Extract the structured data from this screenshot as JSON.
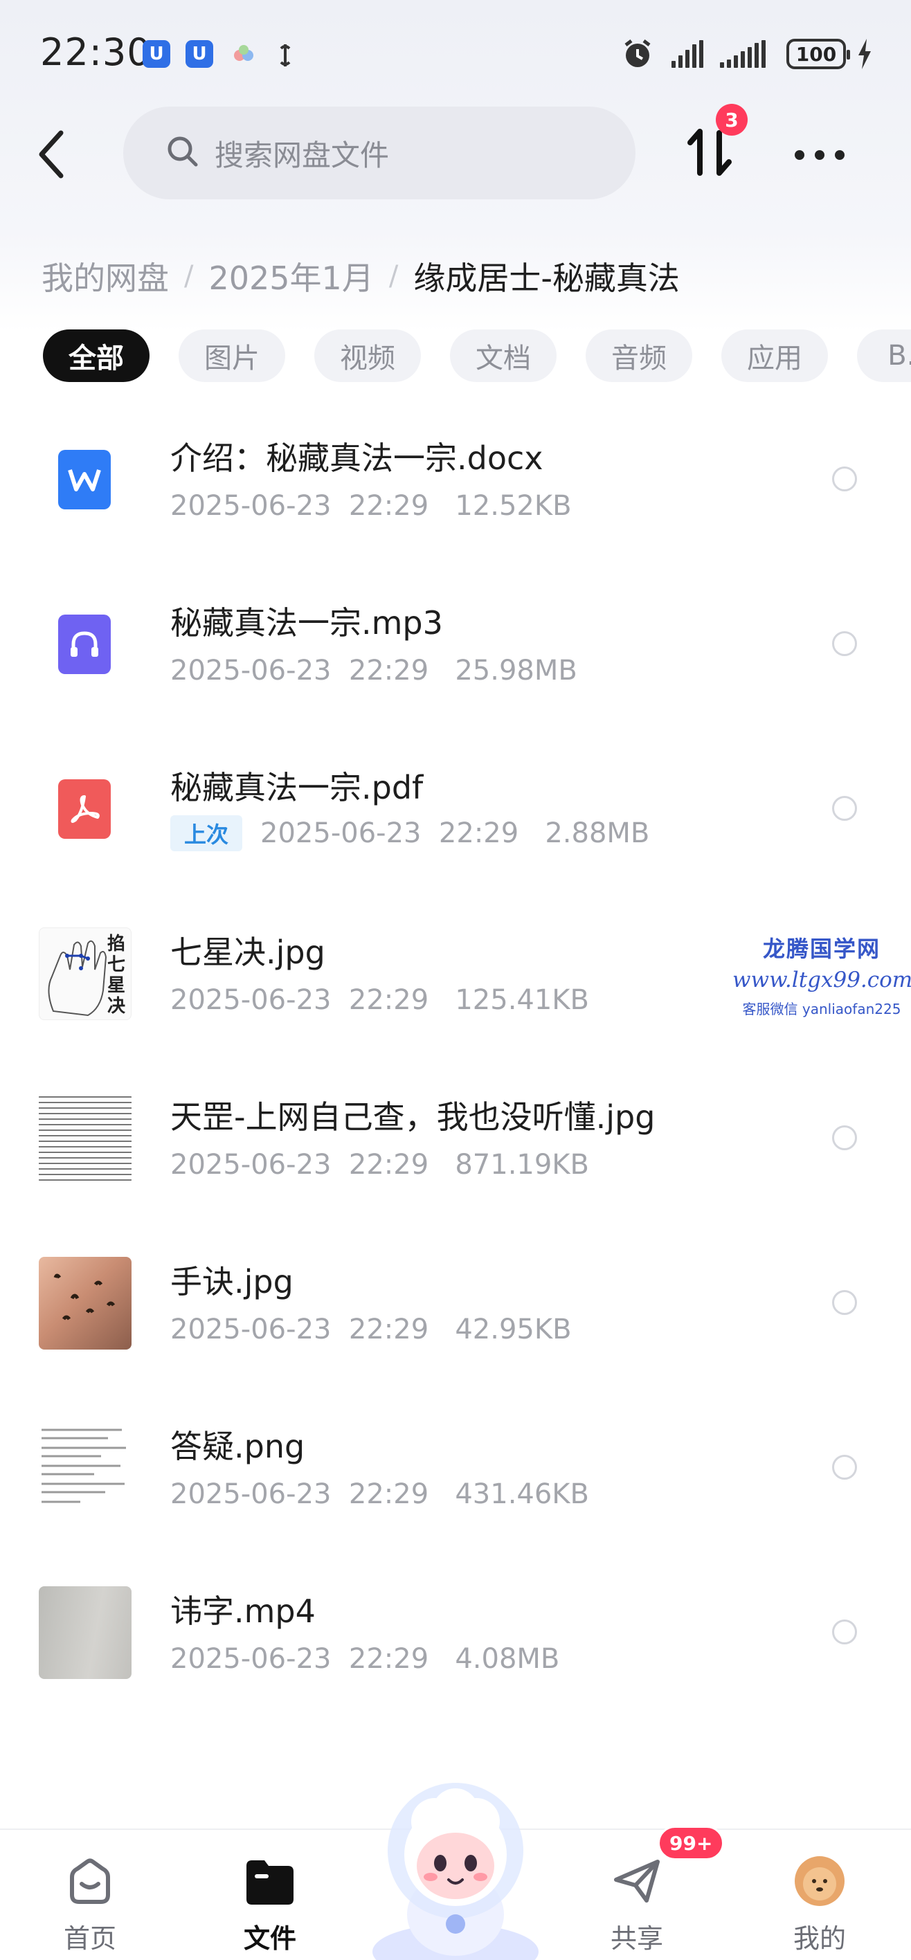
{
  "status_bar": {
    "time": "22:30",
    "app_icon_1": "U",
    "app_icon_2": "U",
    "battery": "100"
  },
  "header": {
    "search_placeholder": "搜索网盘文件",
    "transfer_badge": "3"
  },
  "breadcrumb": {
    "items": [
      "我的网盘",
      "2025年1月"
    ],
    "current": "缘成居士-秘藏真法"
  },
  "tabs": [
    "全部",
    "图片",
    "视频",
    "文档",
    "音频",
    "应用",
    "B..."
  ],
  "files": [
    {
      "name": "介绍：秘藏真法一宗.docx",
      "date": "2025-06-23",
      "time": "22:29",
      "size": "12.52KB",
      "icon": "word-doc-icon"
    },
    {
      "name": "秘藏真法一宗.mp3",
      "date": "2025-06-23",
      "time": "22:29",
      "size": "25.98MB",
      "icon": "audio-file-icon"
    },
    {
      "name": "秘藏真法一宗.pdf",
      "badge": "上次",
      "date": "2025-06-23",
      "time": "22:29",
      "size": "2.88MB",
      "icon": "pdf-file-icon"
    },
    {
      "name": "七星决.jpg",
      "date": "2025-06-23",
      "time": "22:29",
      "size": "125.41KB",
      "icon": "image-thumbnail"
    },
    {
      "name": "天罡-上网自己查，我也没听懂.jpg",
      "date": "2025-06-23",
      "time": "22:29",
      "size": "871.19KB",
      "icon": "image-thumbnail"
    },
    {
      "name": "手诀.jpg",
      "date": "2025-06-23",
      "time": "22:29",
      "size": "42.95KB",
      "icon": "image-thumbnail"
    },
    {
      "name": "答疑.png",
      "date": "2025-06-23",
      "time": "22:29",
      "size": "431.46KB",
      "icon": "image-thumbnail"
    },
    {
      "name": "讳字.mp4",
      "date": "2025-06-23",
      "time": "22:29",
      "size": "4.08MB",
      "icon": "video-thumbnail"
    }
  ],
  "thumb_text": {
    "qixing": "掐七星决"
  },
  "watermark": {
    "title": "龙腾国学网",
    "url": "www.ltgx99.com",
    "sub": "客服微信 yanliaofan225"
  },
  "bottom_nav": {
    "home": "首页",
    "files": "文件",
    "share": "共享",
    "share_badge": "99+",
    "mine": "我的"
  },
  "colors": {
    "accent_red": "#ff3b5c",
    "doc_blue": "#2f7cf6",
    "audio_purple": "#6f62f2",
    "pdf_red": "#f05a5a",
    "badge_blue": "#2a8ae0"
  }
}
